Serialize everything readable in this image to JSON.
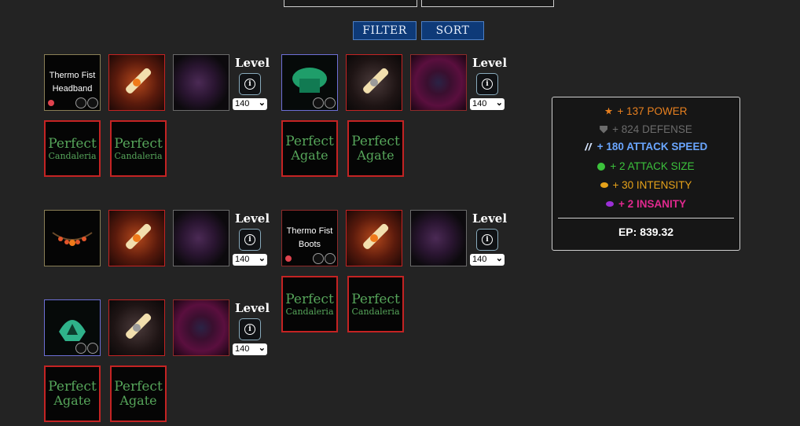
{
  "toolbar": {
    "filter_label": "FILTER",
    "sort_label": "SORT"
  },
  "level_label": "Level",
  "gems": {
    "candaleria": {
      "line1": "Perfect",
      "line2": "Candaleria"
    },
    "agate": {
      "line1": "Perfect",
      "line2": "Agate"
    }
  },
  "items": {
    "headband": {
      "name_line1": "Thermo Fist",
      "name_line2": "Headband"
    },
    "boots": {
      "name_line1": "Thermo Fist",
      "name_line2": "Boots"
    }
  },
  "builds": [
    {
      "level": "140"
    },
    {
      "level": "140"
    },
    {
      "level": "140"
    },
    {
      "level": "140"
    },
    {
      "level": "140"
    }
  ],
  "stats": {
    "power": "+ 137 POWER",
    "defense": "+ 824 DEFENSE",
    "attack_speed": "+ 180 ATTACK SPEED",
    "attack_size": "+ 2 ATTACK SIZE",
    "intensity": "+ 30 INTENSITY",
    "insanity": "+ 2 INSANITY",
    "ep": "EP: 839.32",
    "colors": {
      "power": "#e8801f",
      "defense": "#6c6c6c",
      "attack_speed": "#6aa6ff",
      "attack_size": "#3cc23c",
      "intensity": "#e6a21a",
      "insanity": "#e0298e"
    }
  }
}
